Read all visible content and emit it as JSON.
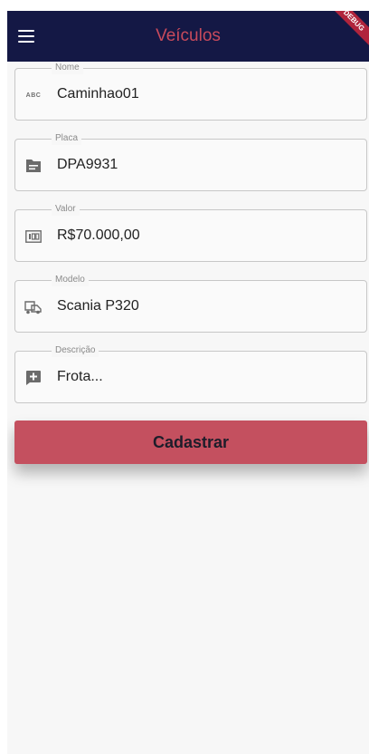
{
  "app_bar": {
    "title": "Veículos",
    "debug_banner": "DEBUG",
    "menu_icon": "hamburger-menu-icon"
  },
  "form": {
    "fields": [
      {
        "label": "Nome",
        "value": "Caminhao01",
        "icon": "abc-icon"
      },
      {
        "label": "Placa",
        "value": "DPA9931",
        "icon": "card-icon"
      },
      {
        "label": "Valor",
        "value": "R$70.000,00",
        "icon": "money-icon"
      },
      {
        "label": "Modelo",
        "value": "Scania P320",
        "icon": "truck-icon"
      },
      {
        "label": "Descrição",
        "value": "Frota...",
        "icon": "add-box-icon"
      }
    ],
    "submit_label": "Cadastrar"
  },
  "colors": {
    "app_bar": "#141845",
    "accent": "#c84a5c",
    "button": "#c4505f"
  }
}
